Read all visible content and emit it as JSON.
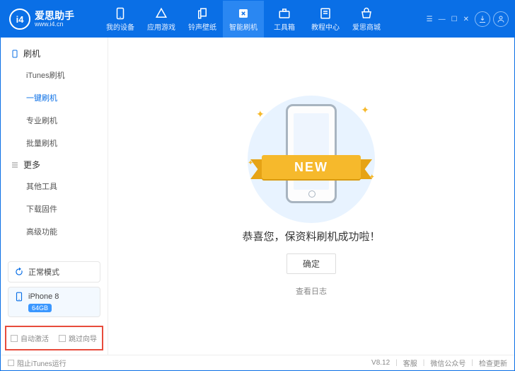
{
  "app": {
    "name": "爱思助手",
    "site": "www.i4.cn",
    "logo_glyph": "i4"
  },
  "nav": [
    {
      "id": "devices",
      "label": "我的设备"
    },
    {
      "id": "games",
      "label": "应用游戏"
    },
    {
      "id": "ringtones",
      "label": "铃声壁纸"
    },
    {
      "id": "flash",
      "label": "智能刷机",
      "active": true
    },
    {
      "id": "toolbox",
      "label": "工具箱"
    },
    {
      "id": "tutorial",
      "label": "教程中心"
    },
    {
      "id": "store",
      "label": "爱思商城"
    }
  ],
  "header_icons": {
    "download": "⬇",
    "user": "👤"
  },
  "win_controls": [
    "☰",
    "—",
    "☐",
    "✕"
  ],
  "sidebar": {
    "sections": [
      {
        "id": "flash",
        "title": "刷机",
        "icon": "phone",
        "items": [
          {
            "id": "itunes",
            "label": "iTunes刷机"
          },
          {
            "id": "oneclick",
            "label": "一键刷机",
            "active": true
          },
          {
            "id": "pro",
            "label": "专业刷机"
          },
          {
            "id": "batch",
            "label": "批量刷机"
          }
        ]
      },
      {
        "id": "more",
        "title": "更多",
        "icon": "list",
        "items": [
          {
            "id": "othertools",
            "label": "其他工具"
          },
          {
            "id": "firmware",
            "label": "下载固件"
          },
          {
            "id": "advanced",
            "label": "高级功能"
          }
        ]
      }
    ],
    "mode": {
      "label": "正常模式"
    },
    "device": {
      "name": "iPhone 8",
      "storage": "64GB"
    },
    "checks": [
      {
        "id": "autoactivate",
        "label": "自动激活"
      },
      {
        "id": "skipguide",
        "label": "跳过向导"
      }
    ]
  },
  "main": {
    "ribbon": "NEW",
    "message": "恭喜您，保资料刷机成功啦！",
    "ok": "确定",
    "view_log": "查看日志"
  },
  "footer": {
    "block_itunes": "阻止iTunes运行",
    "version": "V8.12",
    "support": "客服",
    "wechat": "微信公众号",
    "update": "检查更新"
  }
}
